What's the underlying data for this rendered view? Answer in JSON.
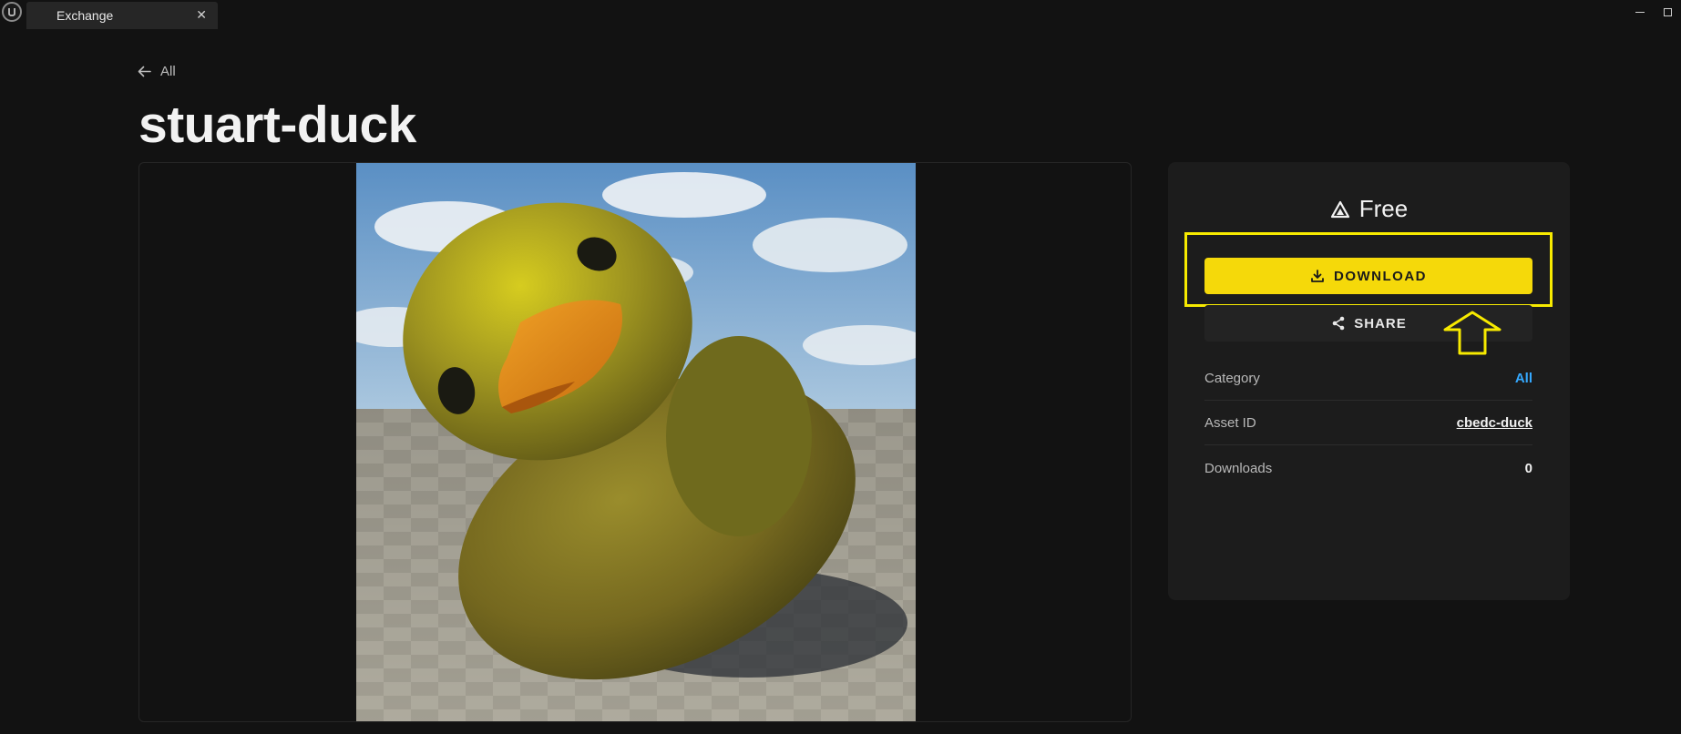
{
  "window": {
    "tab_title": "Exchange",
    "tab_close_icon": "close-icon"
  },
  "nav": {
    "back_label": "All"
  },
  "asset": {
    "title": "stuart-duck",
    "price": "Free",
    "download_label": "DOWNLOAD",
    "share_label": "SHARE"
  },
  "details": [
    {
      "label": "Category",
      "value": "All"
    },
    {
      "label": "Asset ID",
      "value": "cbedc-duck"
    },
    {
      "label": "Downloads",
      "value": "0"
    }
  ],
  "colors": {
    "background": "#121212",
    "panel": "#1c1c1c",
    "accent_yellow": "#f5d90a",
    "highlight_yellow": "#f7ea00",
    "link_blue": "#35a9ff"
  }
}
